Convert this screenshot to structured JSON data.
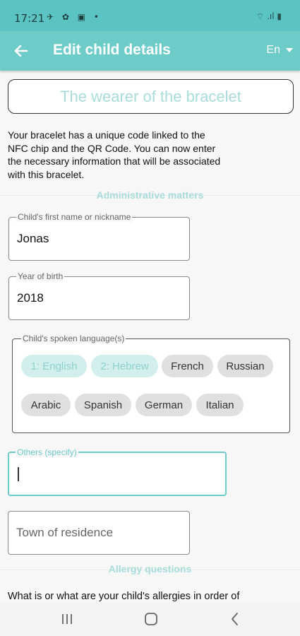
{
  "status_bar": {
    "time": "17:21",
    "left_icons": "✈ ✿ ▣ •",
    "right_icons": "⌔ .ıl ▮"
  },
  "app_bar": {
    "title": "Edit child details",
    "language": "En"
  },
  "section_title": "The wearer of the bracelet",
  "intro": "Your bracelet has a unique code linked to the NFC chip and the QR Code. You can now enter the necessary information that will be associated with this bracelet.",
  "sections": {
    "administrative": "Administrative matters",
    "allergy": "Allergy questions"
  },
  "fields": {
    "first_name": {
      "label": "Child's first name or nickname",
      "value": "Jonas"
    },
    "year_of_birth": {
      "label": "Year of birth",
      "value": "2018"
    },
    "others": {
      "label": "Others (specify)",
      "value": ""
    },
    "town": {
      "placeholder": "Town of residence"
    }
  },
  "languages": {
    "label": "Child's spoken language(s)",
    "chips": [
      {
        "label": "1: English",
        "selected": true
      },
      {
        "label": "2: Hebrew",
        "selected": true
      },
      {
        "label": "French",
        "selected": false
      },
      {
        "label": "Russian",
        "selected": false
      },
      {
        "label": "Arabic",
        "selected": false
      },
      {
        "label": "Spanish",
        "selected": false
      },
      {
        "label": "German",
        "selected": false
      },
      {
        "label": "Italian",
        "selected": false
      }
    ]
  },
  "allergy_question": "What is or what are your child's allergies in order of",
  "colors": {
    "accent": "#6dcbc8",
    "status_bar": "#5bc4c2",
    "chip_selected_bg": "#d2eeed",
    "chip_selected_text": "#8fd0ce",
    "chip_bg": "#e0e0e0"
  },
  "icons": {
    "back": "arrow-left-icon",
    "recent": "recent-apps-icon",
    "home": "home-icon",
    "nav_back": "nav-back-icon"
  }
}
